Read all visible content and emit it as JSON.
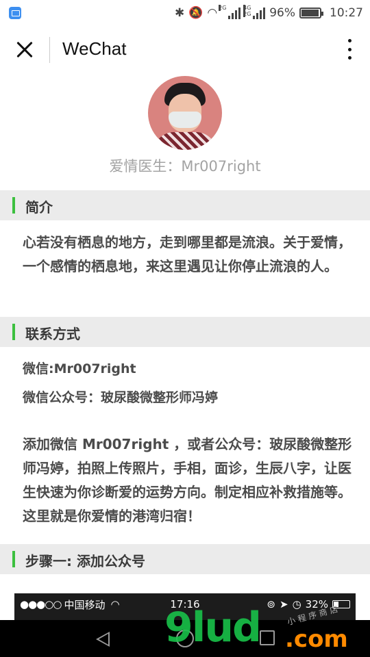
{
  "status_bar": {
    "app_icon": "gallery-icon",
    "bluetooth_icon": "bluetooth-icon",
    "mute_icon": "vibrate-off-icon",
    "wifi_icon": "wifi-icon",
    "sim1_tag": "2G",
    "sim2_tag": "4G 2G",
    "battery_percent": "96%",
    "time": "10:27"
  },
  "header": {
    "close_icon": "close-icon",
    "title": "WeChat",
    "more_icon": "more-vertical-icon"
  },
  "profile": {
    "avatar": "avatar",
    "name": "爱情医生：Mr007right"
  },
  "sections": {
    "intro": {
      "title": "简介",
      "body": "心若没有栖息的地方，走到哪里都是流浪。关于爱情，一个感情的栖息地，来这里遇见让你停止流浪的人。"
    },
    "contact": {
      "title": "联系方式",
      "wechat": "微信:Mr007right",
      "official_account": "微信公众号：玻尿酸微整形师冯婷",
      "body": "添加微信 Mr007right ，或者公众号：玻尿酸微整形师冯婷，拍照上传照片，手相，面诊，生辰八字，让医生快速为你诊断爱的运势方向。制定相应补救措施等。这里就是你爱情的港湾归宿！"
    },
    "step1": {
      "title": "步骤一: 添加公众号"
    }
  },
  "embedded_screenshot": {
    "signal": "●●●○○",
    "carrier": "中国移动",
    "time": "17:16",
    "battery_percent": "32%"
  },
  "nav_bar": {
    "back_icon": "back-icon",
    "home_icon": "home-icon",
    "recents_icon": "recents-icon"
  },
  "watermark": {
    "main": "9lud",
    "suffix": ".com",
    "sub": "小程序商店"
  },
  "colors": {
    "accent_green": "#3cc03f",
    "section_bg": "#ebebeb",
    "name_gray": "#a3a3a3"
  }
}
